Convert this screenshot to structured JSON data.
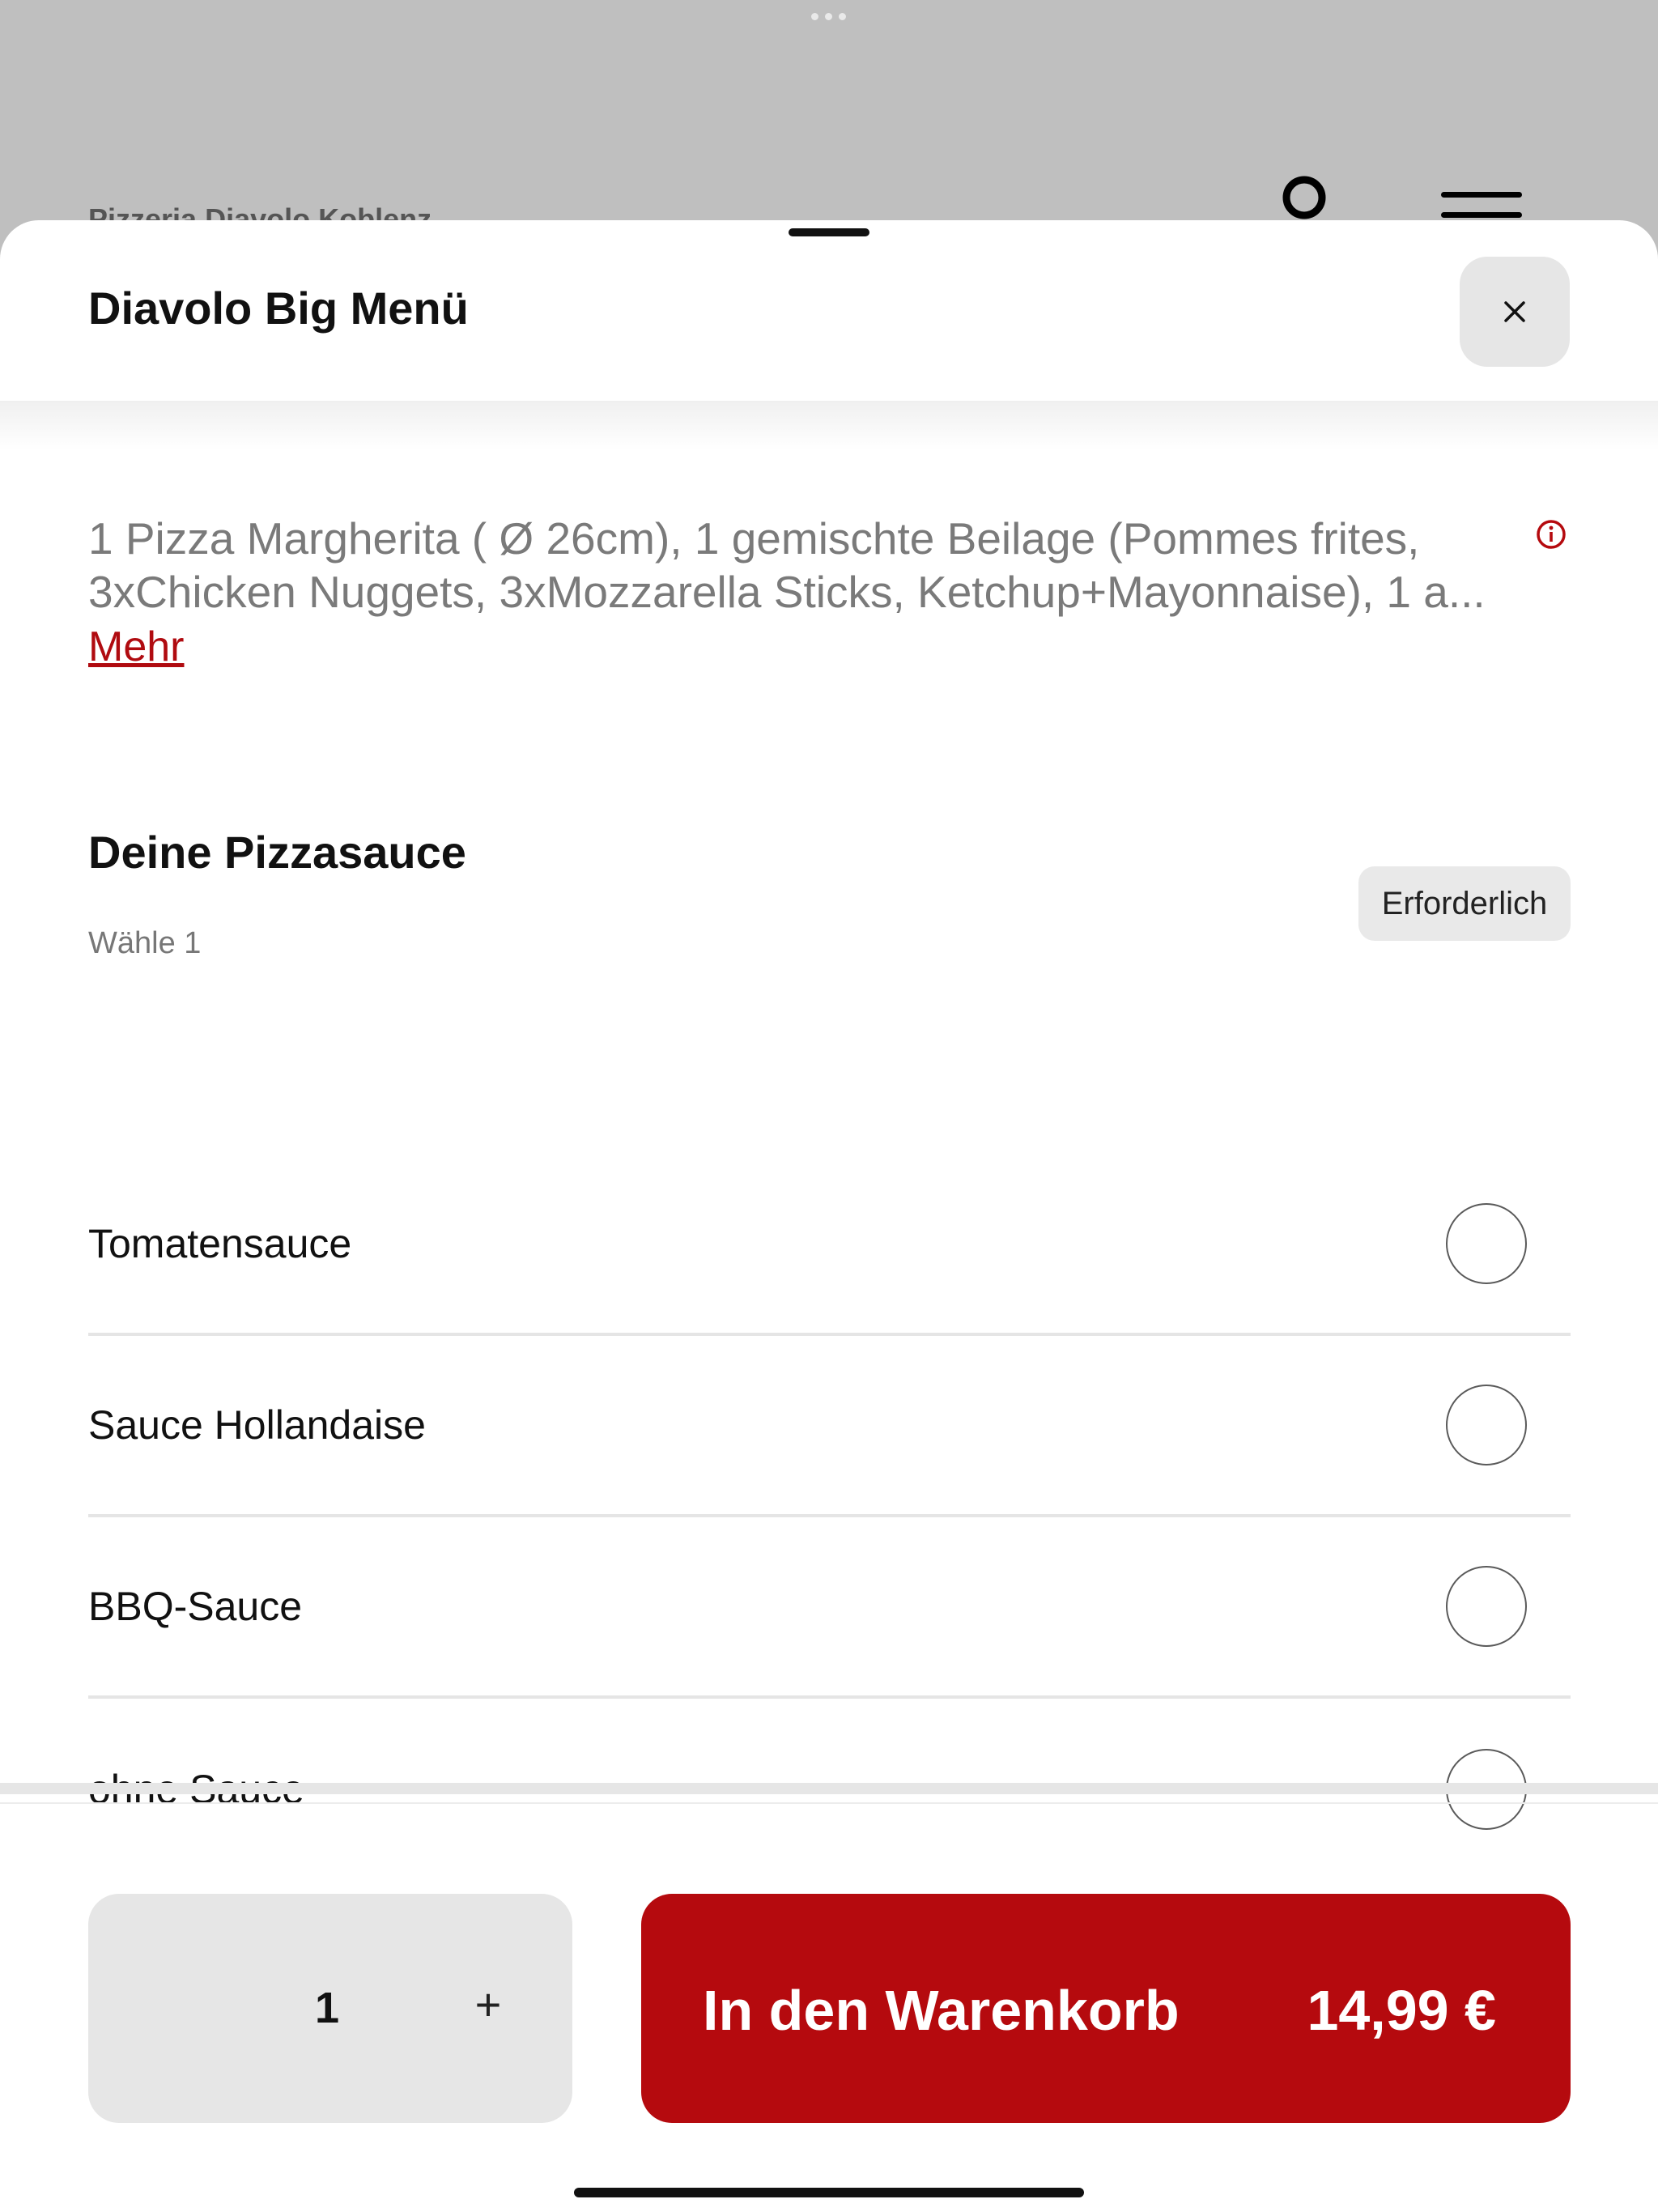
{
  "background": {
    "restaurant_name": "Pizzeria Diavolo Koblenz"
  },
  "sheet": {
    "title": "Diavolo Big Menü",
    "close_icon": "close-icon",
    "description": "1 Pizza Margherita ( Ø 26cm), 1 gemischte Beilage (Pommes frites, 3xChicken Nuggets, 3xMozzarella Sticks, Ketchup+Mayonnaise), 1 a...",
    "more_label": "Mehr",
    "info_icon": "info-icon"
  },
  "section": {
    "title": "Deine Pizzasauce",
    "subtitle": "Wähle 1",
    "badge": "Erforderlich",
    "options": [
      {
        "label": "Tomatensauce",
        "selected": false
      },
      {
        "label": "Sauce Hollandaise",
        "selected": false
      },
      {
        "label": "BBQ-Sauce",
        "selected": false
      },
      {
        "label": "ohne Sauce",
        "selected": false
      }
    ]
  },
  "footer": {
    "quantity": "1",
    "plus_label": "+",
    "cart_label": "In den Warenkorb",
    "price": "14,99 €"
  },
  "colors": {
    "accent": "#b50a0e",
    "overlay": "#bfbfbf"
  }
}
